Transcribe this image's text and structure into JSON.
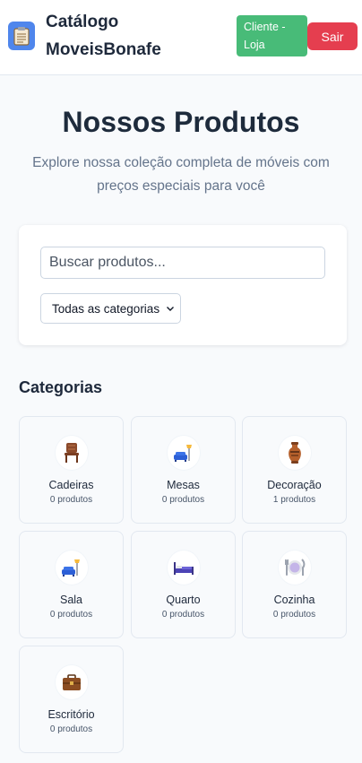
{
  "header": {
    "brand_line1": "Catálogo",
    "brand_line2": "MoveisBonafe",
    "client_button": "Cliente - Loja",
    "exit_button": "Sair",
    "colors": {
      "client": "#48bb78",
      "exit": "#e53e4f",
      "logo": "#4f86ec"
    }
  },
  "hero": {
    "title": "Nossos Produtos",
    "subtitle": "Explore nossa coleção completa de móveis com preços especiais para você"
  },
  "search": {
    "placeholder": "Buscar produtos...",
    "value": "",
    "category_selected": "Todas as categorias"
  },
  "categories": {
    "title": "Categorias",
    "items": [
      {
        "name": "Cadeiras",
        "count": "0 produtos",
        "icon": "chair-icon"
      },
      {
        "name": "Mesas",
        "count": "0 produtos",
        "icon": "sofa-lamp-icon"
      },
      {
        "name": "Decoração",
        "count": "1 produtos",
        "icon": "vase-icon"
      },
      {
        "name": "Sala",
        "count": "0 produtos",
        "icon": "sofa-lamp-icon"
      },
      {
        "name": "Quarto",
        "count": "0 produtos",
        "icon": "bed-icon"
      },
      {
        "name": "Cozinha",
        "count": "0 produtos",
        "icon": "plate-cutlery-icon"
      },
      {
        "name": "Escritório",
        "count": "0 produtos",
        "icon": "briefcase-icon"
      }
    ]
  }
}
